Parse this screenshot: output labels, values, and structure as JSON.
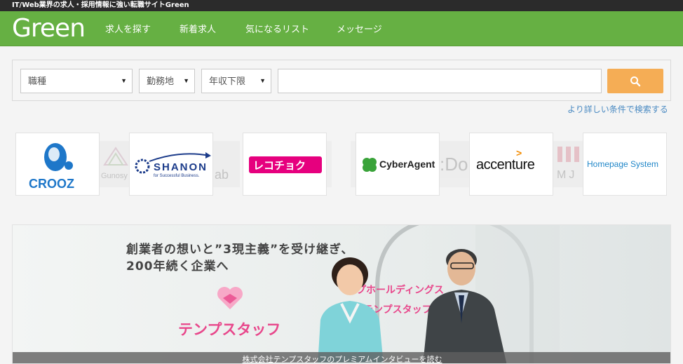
{
  "topbar": {
    "tagline": "IT/Web業界の求人・採用情報に強い転職サイトGreen"
  },
  "header": {
    "logo": "Green",
    "nav": [
      "求人を探す",
      "新着求人",
      "気になるリスト",
      "メッセージ"
    ]
  },
  "search": {
    "job_type": "職種",
    "location": "勤務地",
    "salary": "年収下限",
    "keyword_placeholder": "",
    "detail_link": "より詳しい条件で検索する"
  },
  "companies": {
    "crooz": "CROOZ",
    "gunosy_faded": "Gunosy",
    "shanon_name": "SHANON",
    "shanon_sub": "for Successful Business.",
    "lab_faded": "ab",
    "recochoku": "レコチョク",
    "cyberagent": "CyberAgent",
    "do_faded": ":Do",
    "accenture": "accenture",
    "mj_faded": "MJ",
    "homepage_system": "Homepage System"
  },
  "banner": {
    "headline_1": "創業者の想いと”3現主義”を受け継ぎ、",
    "headline_2": "200年続く企業へ",
    "logo_text": "テンプスタッフ",
    "sign_1": "プホールディングス",
    "sign_2": "テンプスタッフ",
    "caption": "株式会社テンプスタッフのプレミアムインタビューを読む"
  },
  "colors": {
    "brand_green": "#66b043",
    "search_button": "#f5ad55",
    "link_blue": "#4a8ac2",
    "tempstaff_pink": "#e8478b",
    "crooz_blue": "#1e77c9",
    "recochoku_red": "#e6007e"
  },
  "icons": {
    "search_button": "magnifier-icon"
  }
}
